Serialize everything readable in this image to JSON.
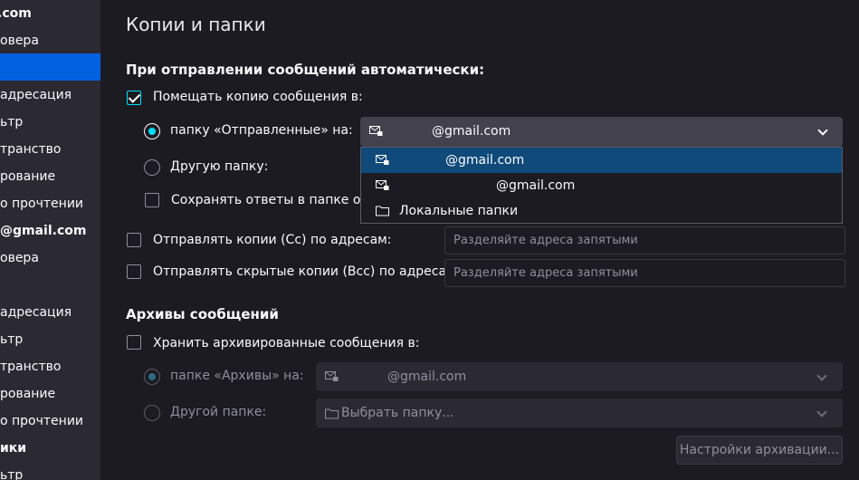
{
  "sidebar": {
    "items": [
      {
        "label": ".com",
        "bold": true
      },
      {
        "label": "овера"
      },
      {
        "label": "",
        "selected": true
      },
      {
        "label": "адресация"
      },
      {
        "label": "ьтр"
      },
      {
        "label": "транство"
      },
      {
        "label": "рование"
      },
      {
        "label": "о прочтении"
      },
      {
        "label": "@gmail.com",
        "bold": true
      },
      {
        "label": "овера"
      },
      {
        "label": ""
      },
      {
        "label": "адресация"
      },
      {
        "label": "ьтр"
      },
      {
        "label": "транство"
      },
      {
        "label": "рование"
      },
      {
        "label": "о прочтении"
      },
      {
        "label": "ики",
        "bold": true
      },
      {
        "label": "ьтр"
      }
    ]
  },
  "page": {
    "title": "Копии и папки"
  },
  "copies": {
    "section_title": "При отправлении сообщений автоматически:",
    "place_copy_label": "Помещать копию сообщения в:",
    "sent_folder_label": "папку «Отправленные» на:",
    "sent_folder_value": "@gmail.com",
    "other_folder_label": "Другую папку:",
    "save_replies_label": "Сохранять ответы в папке ори",
    "cc_label": "Отправлять копии (Cc) по адресам:",
    "cc_placeholder": "Разделяйте адреса запятыми",
    "bcc_label": "Отправлять скрытые копии (Bcc) по адресам:",
    "bcc_placeholder": "Разделяйте адреса запятыми"
  },
  "dropdown": {
    "items": [
      {
        "label": "@gmail.com",
        "icon": "mail-lock-icon",
        "selected": true
      },
      {
        "label": "@gmail.com",
        "icon": "mail-lock-icon"
      },
      {
        "label": "Локальные папки",
        "icon": "folder-icon"
      }
    ]
  },
  "archives": {
    "section_title": "Архивы сообщений",
    "keep_label": "Хранить архивированные сообщения в:",
    "archive_folder_label": "папке «Архивы» на:",
    "archive_folder_value": "@gmail.com",
    "other_folder_label": "Другой папке:",
    "other_folder_value": "Выбрать папку...",
    "settings_button": "Настройки архивации..."
  },
  "colors": {
    "accent": "#00ddff",
    "selection": "#0061e0",
    "background": "#1c1b22"
  }
}
